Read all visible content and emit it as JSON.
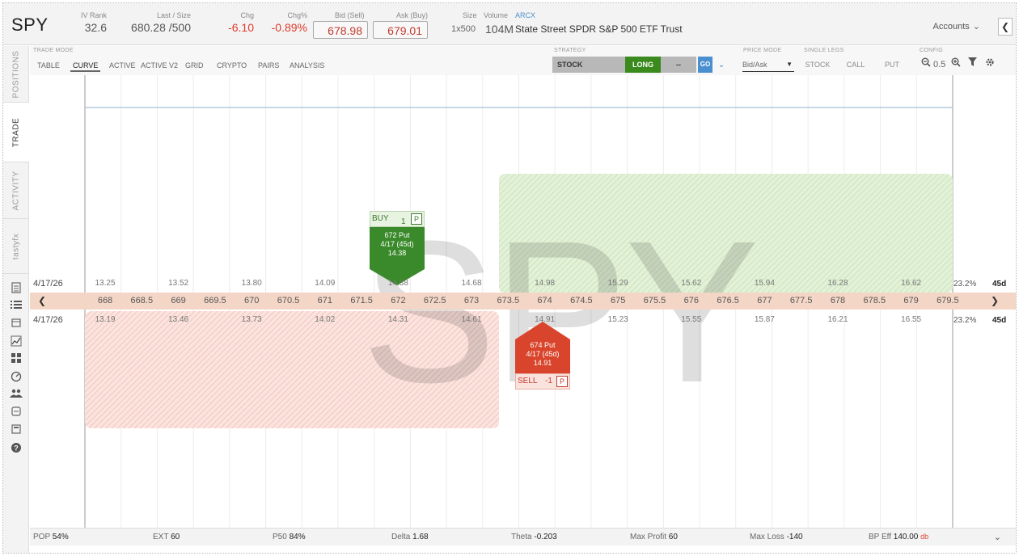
{
  "header": {
    "symbol": "SPY",
    "iv_rank": {
      "label": "IV Rank",
      "value": "32.6"
    },
    "last_size": {
      "label": "Last / Size",
      "value": "680.28 /500"
    },
    "chg": {
      "label": "Chg",
      "value": "-6.10"
    },
    "chg_pct": {
      "label": "Chg%",
      "value": "-0.89%"
    },
    "bid": {
      "label": "Bid (Sell)",
      "value": "678.98"
    },
    "ask": {
      "label": "Ask (Buy)",
      "value": "679.01"
    },
    "size": {
      "label": "Size",
      "value": "1x500"
    },
    "volume": {
      "label": "Volume",
      "value": "104M"
    },
    "exchange": "ARCX",
    "name": "State Street SPDR S&P 500 ETF Trust",
    "accounts_label": "Accounts",
    "collapse_icon": "chevron-left-icon"
  },
  "sidenav": {
    "tabs": [
      "POSITIONS",
      "TRADE",
      "ACTIVITY",
      "tastyfx"
    ],
    "active": "TRADE",
    "icons": [
      "document-icon",
      "list-icon",
      "calendar-icon",
      "chart-icon",
      "grid-icon",
      "gauge-icon",
      "users-icon",
      "archive-icon",
      "calculator-icon",
      "help-icon"
    ]
  },
  "toolbar": {
    "trade_mode_label": "TRADE MODE",
    "modes": [
      "TABLE",
      "CURVE",
      "ACTIVE",
      "ACTIVE V2",
      "GRID",
      "CRYPTO",
      "PAIRS",
      "ANALYSIS"
    ],
    "active_mode": "CURVE",
    "strategy_label": "STRATEGY",
    "strategy": "STOCK",
    "direction": "LONG",
    "dash": "--",
    "go": "GO",
    "price_mode_label": "PRICE MODE",
    "price_mode": "Bid/Ask",
    "single_legs_label": "SINGLE LEGS",
    "legs": [
      "STOCK",
      "CALL",
      "PUT"
    ],
    "config_label": "CONFIG",
    "zoom": "0.5",
    "colors": {
      "long": "#3a8a1e",
      "go": "#4a8fd0",
      "strategy_bg": "#b8b8b8"
    }
  },
  "chart": {
    "watermark": "SPY",
    "date_upper": "4/17/26",
    "date_lower": "4/17/26",
    "upper_prices": [
      "13.25",
      "13.52",
      "13.80",
      "14.09",
      "14.38",
      "14.68",
      "14.98",
      "15.29",
      "15.62",
      "15.94",
      "16.28",
      "16.62"
    ],
    "lower_prices": [
      "13.19",
      "13.46",
      "13.73",
      "14.02",
      "14.31",
      "14.61",
      "14.91",
      "15.23",
      "15.55",
      "15.87",
      "16.21",
      "16.55"
    ],
    "strikes": [
      "668",
      "668.5",
      "669",
      "669.5",
      "670",
      "670.5",
      "671",
      "671.5",
      "672",
      "672.5",
      "673",
      "673.5",
      "674",
      "674.5",
      "675",
      "675.5",
      "676",
      "676.5",
      "677",
      "677.5",
      "678",
      "678.5",
      "679",
      "679.5"
    ],
    "iv_upper": "23.2%",
    "iv_lower": "23.2%",
    "dte_upper": "45d",
    "dte_lower": "45d",
    "buy_order": {
      "side": "BUY",
      "qty": "1",
      "type": "P",
      "line1": "672 Put",
      "line2": "4/17 (45d)",
      "line3": "14.38"
    },
    "sell_order": {
      "side": "SELL",
      "qty": "-1",
      "type": "P",
      "line1": "674 Put",
      "line2": "4/17 (45d)",
      "line3": "14.91"
    },
    "colors": {
      "profit": "#cfe8bf",
      "loss": "#f4c2b8",
      "strike_row": "#f4d6c6",
      "buy": "#3a8a2b",
      "sell": "#d9452c"
    }
  },
  "footer": {
    "pop": {
      "label": "POP",
      "value": "54%"
    },
    "ext": {
      "label": "EXT",
      "value": "60"
    },
    "p50": {
      "label": "P50",
      "value": "84%"
    },
    "delta": {
      "label": "Delta",
      "value": "1.68"
    },
    "theta": {
      "label": "Theta",
      "value": "-0.203"
    },
    "max_profit": {
      "label": "Max Profit",
      "value": "60"
    },
    "max_loss": {
      "label": "Max Loss",
      "value": "-140"
    },
    "bp_eff": {
      "label": "BP Eff",
      "value": "140.00",
      "suffix": "db"
    }
  }
}
